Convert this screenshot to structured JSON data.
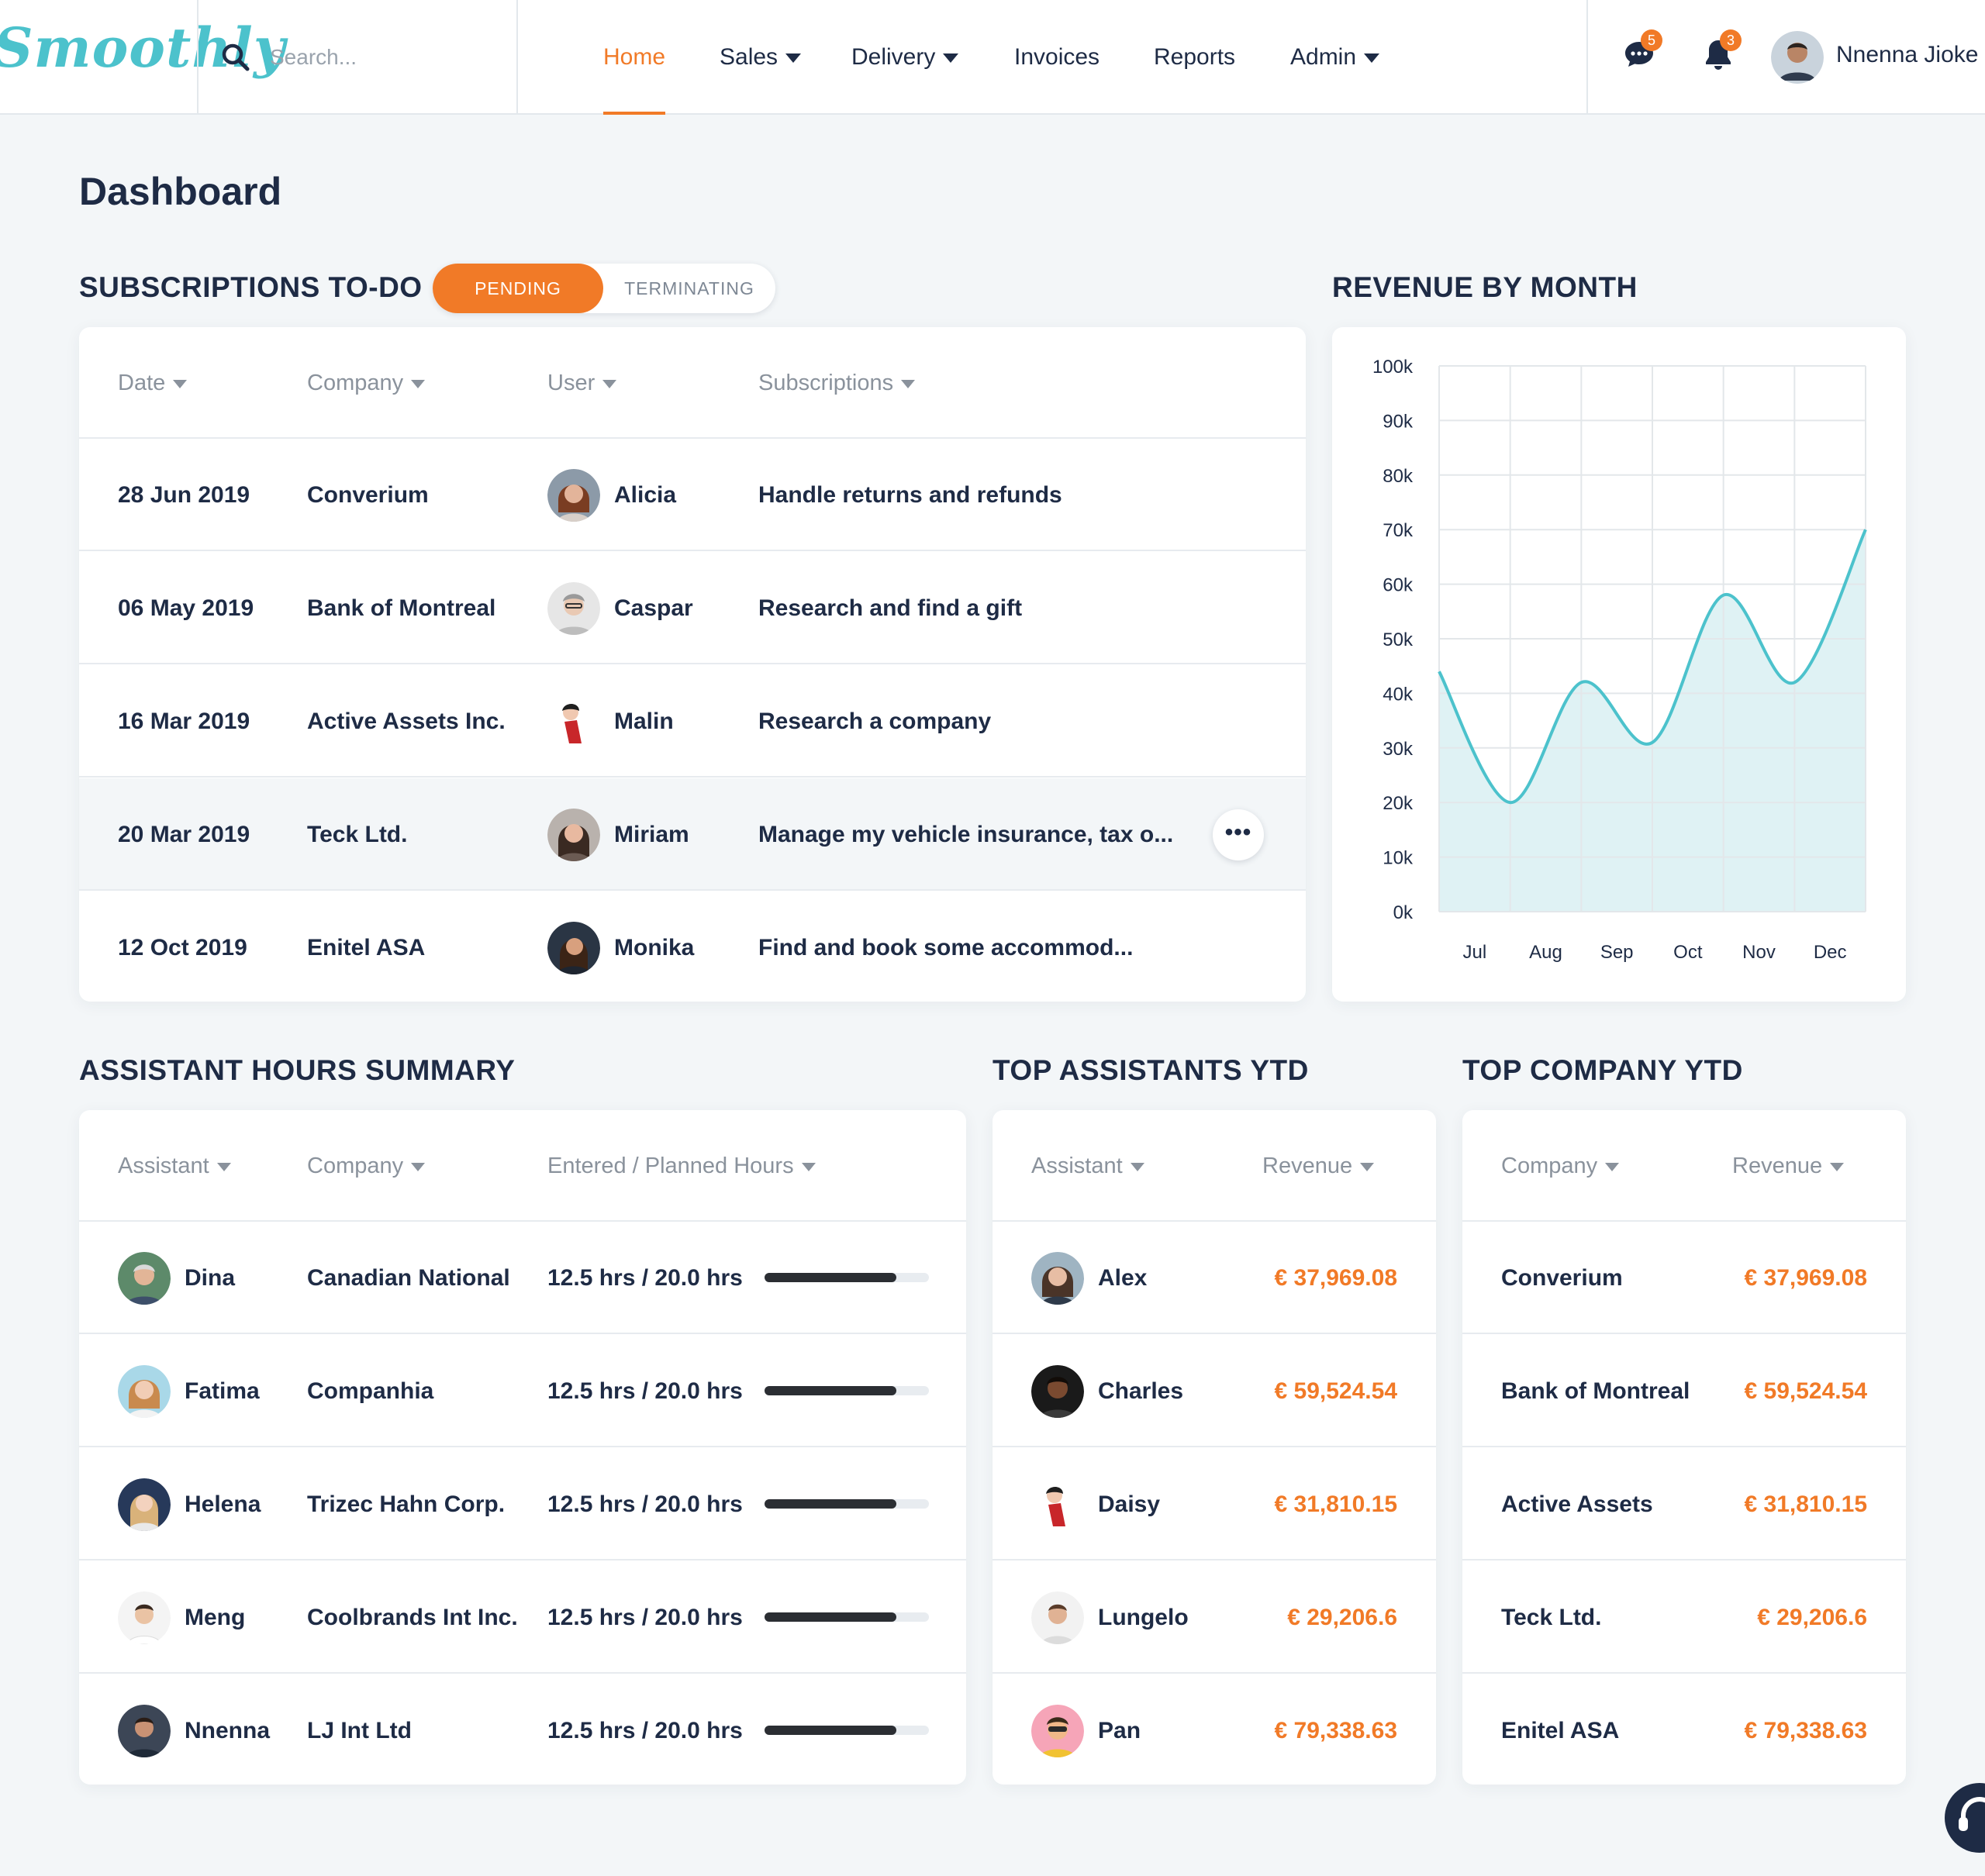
{
  "brand": {
    "logo_text": "Smoothly",
    "accent": "#f17a27",
    "chart_color": "#4cc2cc",
    "dark": "#1e2b45"
  },
  "header": {
    "search_placeholder": "Search...",
    "nav": [
      {
        "label": "Home",
        "active": true,
        "dropdown": false
      },
      {
        "label": "Sales",
        "active": false,
        "dropdown": true
      },
      {
        "label": "Delivery",
        "active": false,
        "dropdown": true
      },
      {
        "label": "Invoices",
        "active": false,
        "dropdown": false
      },
      {
        "label": "Reports",
        "active": false,
        "dropdown": false
      },
      {
        "label": "Admin",
        "active": false,
        "dropdown": true
      }
    ],
    "messages_count": "5",
    "notifications_count": "3",
    "user_name": "Nnenna Jioke",
    "icons": [
      "search-icon",
      "chat-icon",
      "bell-icon",
      "headset-icon"
    ]
  },
  "page": {
    "title": "Dashboard"
  },
  "subscriptions": {
    "title": "SUBSCRIPTIONS TO-DO",
    "toggle": {
      "active": "PENDING",
      "inactive": "TERMINATING"
    },
    "columns": [
      "Date",
      "Company",
      "User",
      "Subscriptions"
    ],
    "rows": [
      {
        "date": "28 Jun 2019",
        "company": "Converium",
        "user": "Alicia",
        "subscription": "Handle returns and refunds"
      },
      {
        "date": "06 May 2019",
        "company": "Bank of Montreal",
        "user": "Caspar",
        "subscription": "Research and find a gift"
      },
      {
        "date": "16 Mar 2019",
        "company": "Active Assets Inc.",
        "user": "Malin",
        "subscription": "Research a company"
      },
      {
        "date": "20 Mar 2019",
        "company": "Teck Ltd.",
        "user": "Miriam",
        "subscription": "Manage my vehicle insurance, tax o..."
      },
      {
        "date": "12 Oct 2019",
        "company": "Enitel ASA",
        "user": "Monika",
        "subscription": "Find and book some accommod..."
      }
    ],
    "more_label": "•••"
  },
  "revenue": {
    "title": "REVENUE BY MONTH"
  },
  "chart_data": {
    "type": "area",
    "title": "REVENUE BY MONTH",
    "xlabel": "",
    "ylabel": "",
    "categories": [
      "Jul",
      "Aug",
      "Sep",
      "Oct",
      "Nov",
      "Dec"
    ],
    "y_ticks": [
      "0k",
      "10k",
      "20k",
      "30k",
      "40k",
      "50k",
      "60k",
      "70k",
      "80k",
      "90k",
      "100k"
    ],
    "ylim": [
      0,
      100000
    ],
    "series": [
      {
        "points": [
          [
            0,
            44000
          ],
          [
            1,
            20000
          ],
          [
            2,
            42000
          ],
          [
            3,
            31000
          ],
          [
            4,
            58000
          ],
          [
            5,
            42000
          ],
          [
            6,
            70000
          ]
        ]
      }
    ],
    "grid": true,
    "legend": "none"
  },
  "hours": {
    "title": "ASSISTANT HOURS SUMMARY",
    "columns": [
      "Assistant",
      "Company",
      "Entered / Planned Hours"
    ],
    "rows": [
      {
        "assistant": "Dina",
        "company": "Canadian National",
        "hours": "12.5 hrs / 20.0 hrs",
        "progress": 0.8
      },
      {
        "assistant": "Fatima",
        "company": "Companhia",
        "hours": "12.5 hrs / 20.0 hrs",
        "progress": 0.8
      },
      {
        "assistant": "Helena",
        "company": "Trizec Hahn Corp.",
        "hours": "12.5 hrs / 20.0 hrs",
        "progress": 0.8
      },
      {
        "assistant": "Meng",
        "company": "Coolbrands Int Inc.",
        "hours": "12.5 hrs / 20.0 hrs",
        "progress": 0.8
      },
      {
        "assistant": "Nnenna",
        "company": "LJ Int Ltd",
        "hours": "12.5 hrs / 20.0 hrs",
        "progress": 0.8
      }
    ]
  },
  "top_assistants": {
    "title": "TOP ASSISTANTS YTD",
    "columns": [
      "Assistant",
      "Revenue"
    ],
    "rows": [
      {
        "name": "Alex",
        "revenue": "€ 37,969.08"
      },
      {
        "name": "Charles",
        "revenue": "€ 59,524.54"
      },
      {
        "name": "Daisy",
        "revenue": "€ 31,810.15"
      },
      {
        "name": "Lungelo",
        "revenue": "€ 29,206.6"
      },
      {
        "name": "Pan",
        "revenue": "€ 79,338.63"
      }
    ]
  },
  "top_company": {
    "title": "TOP COMPANY YTD",
    "columns": [
      "Company",
      "Revenue"
    ],
    "rows": [
      {
        "name": "Converium",
        "revenue": "€ 37,969.08"
      },
      {
        "name": "Bank of Montreal",
        "revenue": "€ 59,524.54"
      },
      {
        "name": "Active Assets",
        "revenue": "€ 31,810.15"
      },
      {
        "name": "Teck Ltd.",
        "revenue": "€ 29,206.6"
      },
      {
        "name": "Enitel ASA",
        "revenue": "€ 79,338.63"
      }
    ]
  }
}
